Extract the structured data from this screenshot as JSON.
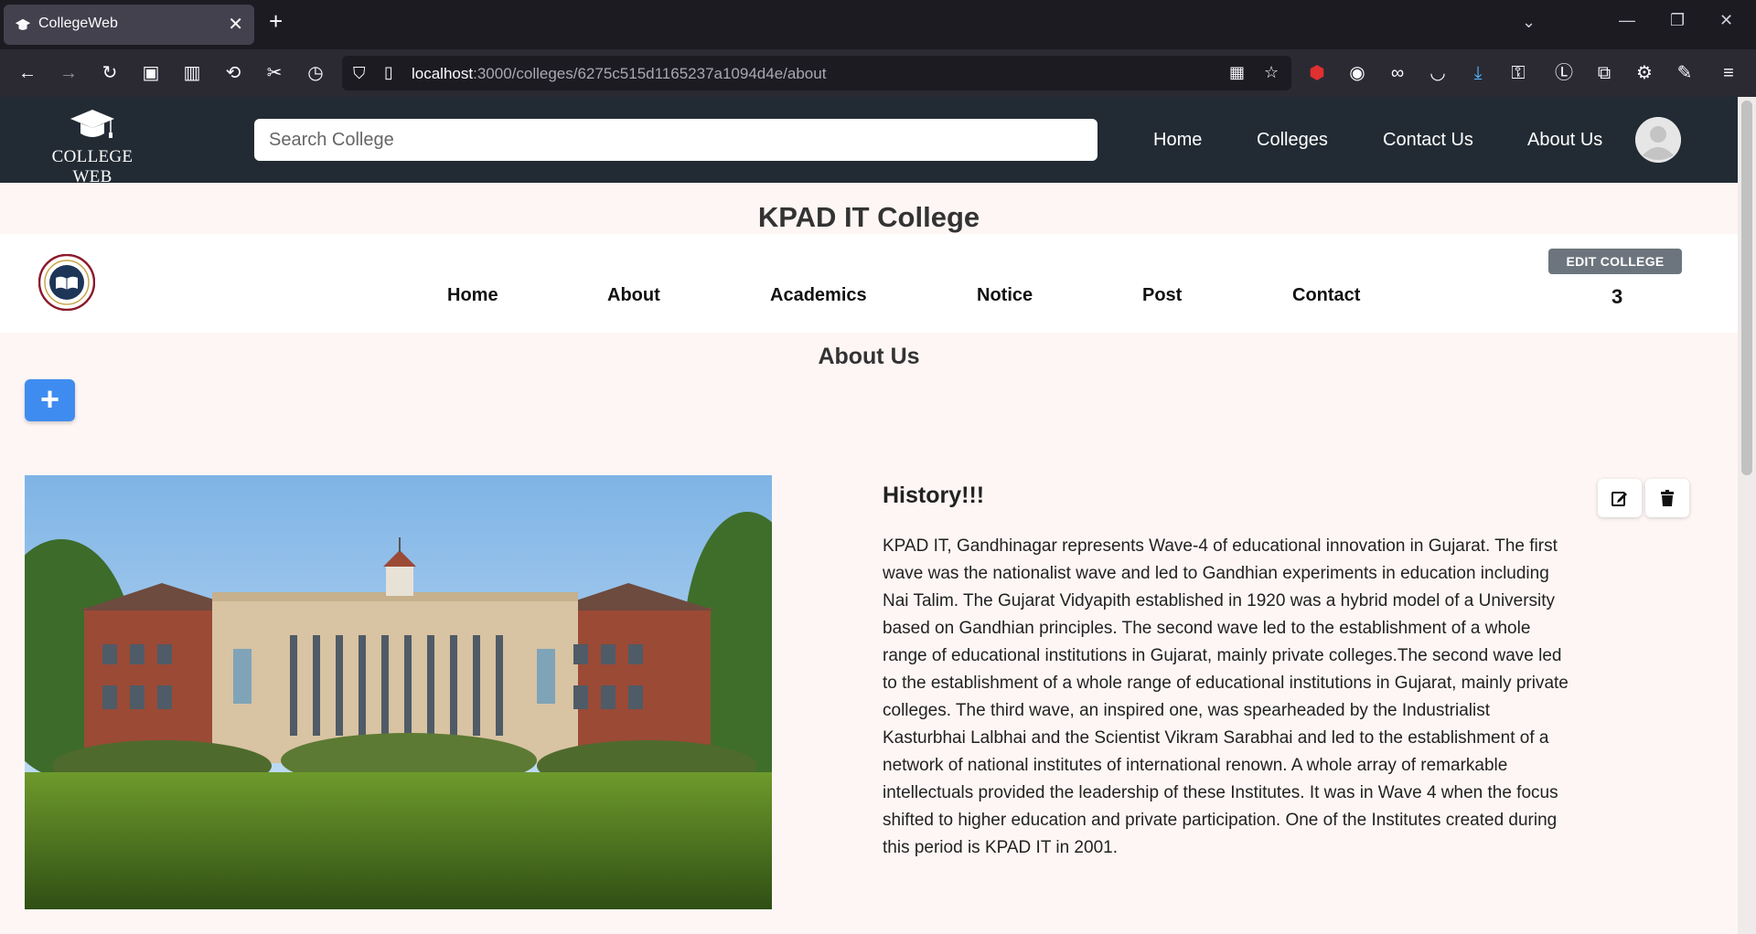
{
  "browser": {
    "tab_title": "CollegeWeb",
    "url_host": "localhost",
    "url_path": ":3000/colleges/6275c515d1165237a1094d4e/about"
  },
  "site": {
    "logo_text": "COLLEGE WEB",
    "search_placeholder": "Search College",
    "nav": [
      "Home",
      "Colleges",
      "Contact Us",
      "About Us"
    ]
  },
  "college": {
    "name": "KPAD IT College",
    "nav": [
      "Home",
      "About",
      "Academics",
      "Notice",
      "Post",
      "Contact"
    ],
    "edit_label": "EDIT COLLEGE",
    "count": "3"
  },
  "about": {
    "title": "About Us",
    "add_label": "+",
    "section_title": "History!!!",
    "section_body": "KPAD IT, Gandhinagar represents Wave-4 of educational innovation in Gujarat. The first wave was the nationalist wave and led to Gandhian experiments in education including Nai Talim. The Gujarat Vidyapith established in 1920 was a hybrid model of a University based on Gandhian principles. The second wave led to the establishment of a whole range of educational institutions in Gujarat, mainly private colleges.The second wave led to the establishment of a whole range of educational institutions in Gujarat, mainly private colleges. The third wave, an inspired one, was spearheaded by the Industrialist Kasturbhai Lalbhai and the Scientist Vikram Sarabhai and led to the establishment of a network of national institutes of international renown. A whole array of remarkable intellectuals provided the leadership of these Institutes. It was in Wave 4 when the focus shifted to higher education and private participation. One of the Institutes created during this period is KPAD IT in 2001."
  },
  "colors": {
    "header_bg": "#222b34",
    "page_bg": "#fdf6f5",
    "add_button": "#3f8cf0",
    "edit_button": "#6c757d"
  },
  "icons": [
    "graduation-cap-icon",
    "college-seal-icon",
    "plus-icon",
    "edit-icon",
    "trash-icon",
    "avatar-icon"
  ]
}
